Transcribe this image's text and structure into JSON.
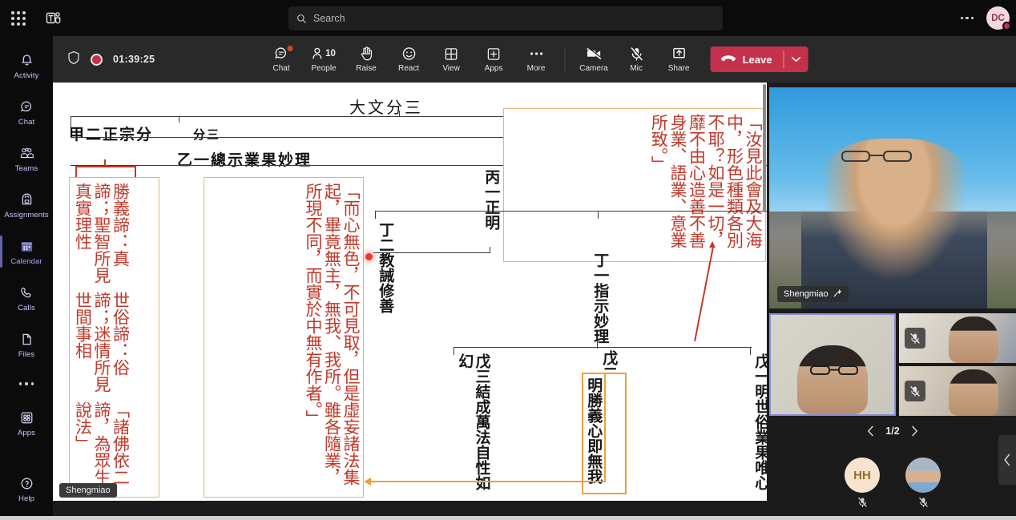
{
  "app": {
    "name": "Microsoft Teams",
    "waffle_icon": "app-launcher-icon",
    "logo_icon": "teams-logo-icon"
  },
  "search": {
    "placeholder": "Search",
    "icon": "search-icon"
  },
  "account": {
    "initials": "DC",
    "status": "busy",
    "status_color": "#c4314b",
    "settings_icon": "more-options-icon"
  },
  "sidebar": {
    "items": [
      {
        "label": "Activity",
        "icon": "bell-icon",
        "active": false
      },
      {
        "label": "Chat",
        "icon": "chat-bubble-icon",
        "active": false
      },
      {
        "label": "Teams",
        "icon": "people-group-icon",
        "active": false
      },
      {
        "label": "Assignments",
        "icon": "backpack-icon",
        "active": false
      },
      {
        "label": "Calendar",
        "icon": "calendar-icon",
        "active": true
      },
      {
        "label": "Calls",
        "icon": "phone-icon",
        "active": false
      },
      {
        "label": "Files",
        "icon": "file-icon",
        "active": false
      }
    ],
    "more_icon": "more-apps-icon",
    "apps": {
      "label": "Apps",
      "icon": "apps-grid-icon"
    },
    "help": {
      "label": "Help",
      "icon": "help-circle-icon"
    }
  },
  "meeting": {
    "shield_icon": "shield-icon",
    "recording_icon": "recording-dot-icon",
    "timer": "01:39:25",
    "tools": [
      {
        "label": "Chat",
        "icon": "chat-icon",
        "badge": true
      },
      {
        "label": "People",
        "icon": "person-icon",
        "count": "10"
      },
      {
        "label": "Raise",
        "icon": "raise-hand-icon"
      },
      {
        "label": "React",
        "icon": "smiley-icon"
      },
      {
        "label": "View",
        "icon": "grid-view-icon"
      },
      {
        "label": "Apps",
        "icon": "plus-box-icon"
      },
      {
        "label": "More",
        "icon": "ellipsis-icon"
      }
    ],
    "controls": [
      {
        "label": "Camera",
        "icon": "camera-off-icon",
        "state": "off"
      },
      {
        "label": "Mic",
        "icon": "mic-off-icon",
        "state": "muted"
      },
      {
        "label": "Share",
        "icon": "share-screen-icon",
        "state": "on"
      }
    ],
    "leave": {
      "label": "Leave",
      "icon": "hangup-icon",
      "chevron_icon": "chevron-down-icon",
      "color": "#c4314b"
    }
  },
  "share": {
    "presenter_tag": "Shengmiao",
    "title": "大文分三",
    "outline": {
      "jia2": "甲二正宗分",
      "jia2_sub": "分三",
      "yi1": "乙一總示業果妙理",
      "bing1": "丙一正明",
      "ding1": "丁一指示妙理",
      "ding2": "丁二教誡修善",
      "wu1": "戊一明世俗業果唯心",
      "wu2": "戊二明勝義心即無我",
      "wu3": "戊三結成萬法自性如幻"
    },
    "quotes": [
      "「諸佛依二諦，為眾生說法」",
      "世俗諦：俗諦；迷情所見世間事相",
      "勝義諦：真諦；聖智所見真實理性"
    ],
    "quote_block_2": "「而心無色，不可見取，但是虛妄諸法集起，畢竟無主，無我、我所。雖各隨業，所現不同，而實於中無有作者。」",
    "quote_block_3": "「汝見此會及大海中，形色種類各別不耶？如是一切，靡不由心造善不善身業、語業、意業所致。」",
    "colors": {
      "red_text": "#c0392b",
      "box_border": "#e3b778",
      "highlight_border": "#e8a33d"
    },
    "scrollbar_icon": "vertical-scrollbar"
  },
  "video": {
    "main": {
      "name": "Shengmiao",
      "pin_icon": "pin-icon"
    },
    "thumbnails": [
      {
        "speaking": true,
        "muted": false,
        "mute_icon": "mic-off-icon"
      },
      {
        "speaking": false,
        "muted": true,
        "mute_icon": "mic-off-icon"
      },
      {
        "speaking": false,
        "muted": true,
        "mute_icon": "mic-off-icon"
      }
    ],
    "pager": {
      "prev_icon": "chevron-left-icon",
      "next_icon": "chevron-right-icon",
      "text": "1/2"
    },
    "avatars": [
      {
        "initials": "HH",
        "muted": true,
        "mute_icon": "mic-off-icon",
        "type": "initials"
      },
      {
        "initials": "",
        "muted": true,
        "mute_icon": "mic-off-icon",
        "type": "photo"
      }
    ],
    "collapse_icon": "chevron-left-icon"
  }
}
